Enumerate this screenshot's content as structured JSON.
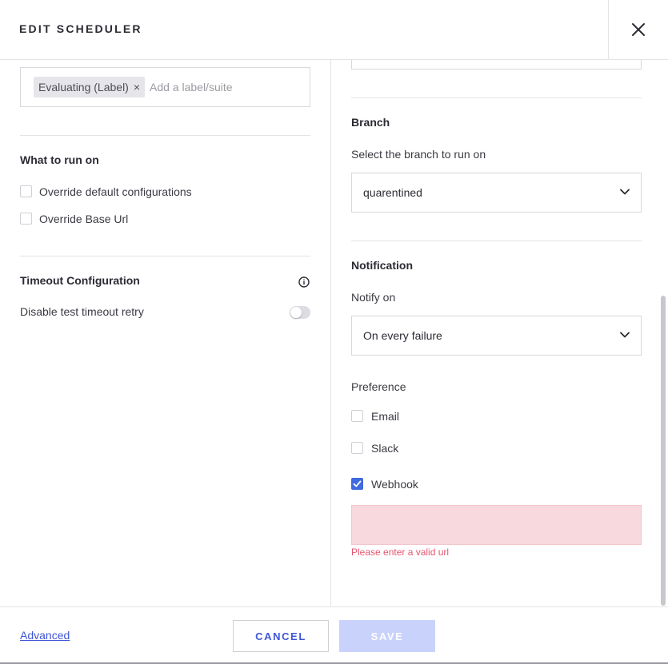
{
  "header": {
    "title": "EDIT SCHEDULER",
    "close_icon": "close-icon"
  },
  "labels_field": {
    "chips": [
      {
        "label": "Evaluating (Label)",
        "remove_symbol": "×"
      }
    ],
    "placeholder": "Add a label/suite"
  },
  "what_to_run": {
    "title": "What to run on",
    "options": [
      {
        "label": "Override default configurations",
        "checked": false
      },
      {
        "label": "Override Base Url",
        "checked": false
      }
    ]
  },
  "timeout": {
    "title": "Timeout Configuration",
    "info_icon": "info-icon",
    "toggle_label": "Disable test timeout retry",
    "toggle_on": false
  },
  "branch": {
    "title": "Branch",
    "label": "Select the branch to run on",
    "selected": "quarentined"
  },
  "notification": {
    "title": "Notification",
    "notify_label": "Notify on",
    "notify_selected": "On every failure",
    "preference_label": "Preference",
    "preferences": [
      {
        "label": "Email",
        "checked": false
      },
      {
        "label": "Slack",
        "checked": false
      },
      {
        "label": "Webhook",
        "checked": true
      }
    ],
    "webhook_value": "",
    "webhook_error": "Please enter a valid url"
  },
  "footer": {
    "advanced_label": "Advanced",
    "cancel_label": "CANCEL",
    "save_label": "SAVE"
  },
  "colors": {
    "accent": "#3f56d6",
    "checkbox_checked": "#3f6ae0",
    "error": "#e5566d",
    "error_bg": "#f8d9de",
    "save_disabled": "#c9d2fb"
  }
}
